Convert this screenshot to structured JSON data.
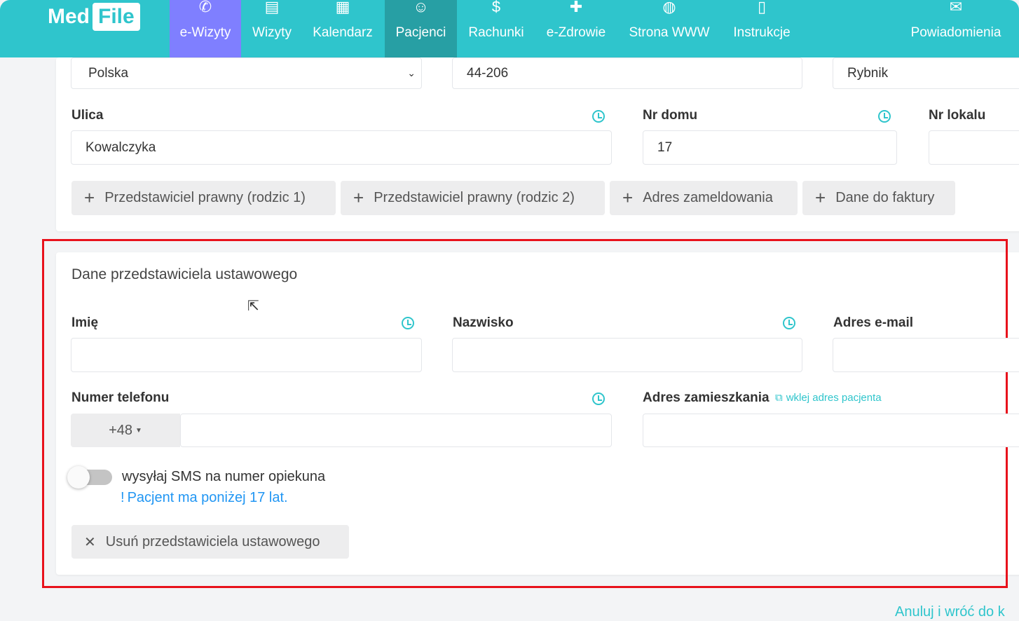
{
  "nav": {
    "logo": "MedFile",
    "logo_a": "Med",
    "logo_b": "File",
    "items": [
      {
        "label": "e-Wizyty",
        "icon": "phone-icon"
      },
      {
        "label": "Wizyty",
        "icon": "list-icon"
      },
      {
        "label": "Kalendarz",
        "icon": "calendar-icon"
      },
      {
        "label": "Pacjenci",
        "icon": "patients-icon"
      },
      {
        "label": "Rachunki",
        "icon": "dollar-icon"
      },
      {
        "label": "e-Zdrowie",
        "icon": "medical-icon"
      },
      {
        "label": "Strona WWW",
        "icon": "globe-icon"
      },
      {
        "label": "Instrukcje",
        "icon": "book-icon"
      },
      {
        "label": "Powiadomienia",
        "icon": "mail-icon"
      }
    ],
    "active": "Pacjenci",
    "highlight": "e-Wizyty",
    "colors": {
      "bar": "#2fc5cc",
      "active": "#279fa4",
      "highlight": "#7f7fff"
    }
  },
  "address": {
    "country": "Polska",
    "postal": "44-206",
    "city": "Rybnik",
    "street_label": "Ulica",
    "street": "Kowalczyka",
    "house_label": "Nr domu",
    "house": "17",
    "flat_label": "Nr lokalu",
    "flat": ""
  },
  "add_buttons": [
    "Przedstawiciel prawny (rodzic 1)",
    "Przedstawiciel prawny (rodzic 2)",
    "Adres zameldowania",
    "Dane do faktury"
  ],
  "guardian": {
    "title": "Dane przedstawiciela ustawowego",
    "first_name_label": "Imię",
    "first_name": "",
    "last_name_label": "Nazwisko",
    "last_name": "",
    "email_label": "Adres e-mail",
    "email": "",
    "phone_label": "Numer telefonu",
    "phone_prefix": "+48",
    "phone": "",
    "address_label": "Adres zamieszkania",
    "paste_link": "wklej adres pacjenta",
    "address": "",
    "sms_toggle_label": "wysyłaj SMS na numer opiekuna",
    "sms_toggle_on": false,
    "note": "Pacjent ma poniżej 17 lat.",
    "remove_button": "Usuń przedstawiciela ustawowego"
  },
  "footer": {
    "cancel_link": "Anuluj i wróć do k"
  },
  "highlight_color": "#e8121c"
}
